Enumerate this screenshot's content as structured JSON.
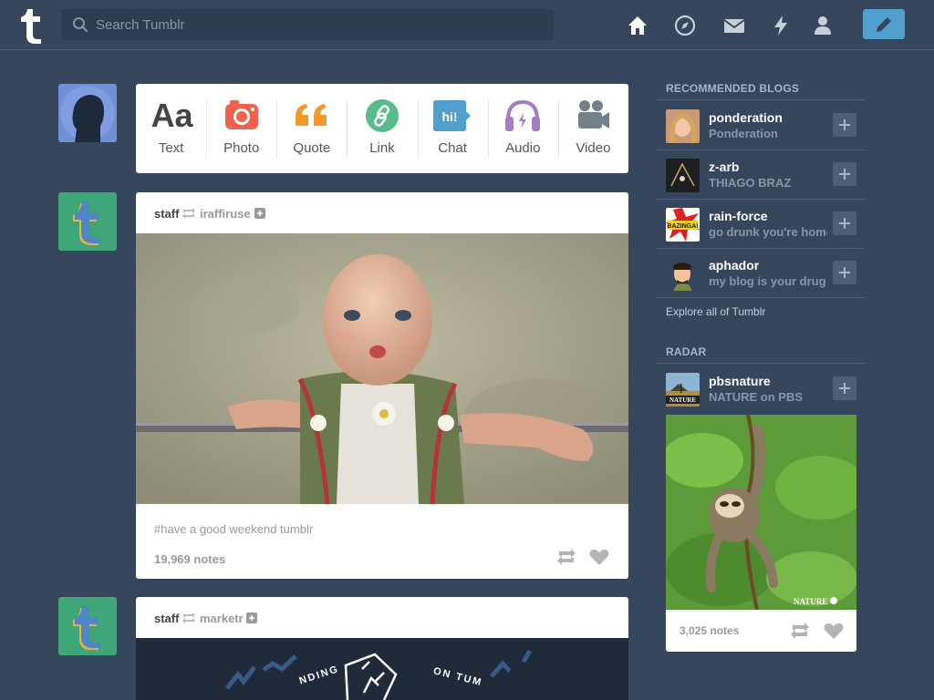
{
  "header": {
    "search_placeholder": "Search Tumblr",
    "nav_icons": [
      "home-icon",
      "explore-icon",
      "inbox-icon",
      "activity-icon",
      "account-icon"
    ],
    "compose_icon": "pencil-icon",
    "accent_color": "#529ecc",
    "background_color": "#36465d"
  },
  "post_types": [
    {
      "label": "Text",
      "icon": "text-icon",
      "color": "#444444"
    },
    {
      "label": "Photo",
      "icon": "camera-icon",
      "color": "#f0624e"
    },
    {
      "label": "Quote",
      "icon": "quote-icon",
      "color": "#f2992e"
    },
    {
      "label": "Link",
      "icon": "link-icon",
      "color": "#56bc8a"
    },
    {
      "label": "Chat",
      "icon": "chat-icon",
      "color": "#529ecc"
    },
    {
      "label": "Audio",
      "icon": "headphones-icon",
      "color": "#a77dc2"
    },
    {
      "label": "Video",
      "icon": "video-camera-icon",
      "color": "#748089"
    }
  ],
  "posts": [
    {
      "author": "staff",
      "reblogged_from": "iraffiruse",
      "tags": "#have a good weekend tumblr",
      "notes": "19,969 notes"
    },
    {
      "author": "staff",
      "reblogged_from": "marketr",
      "image_text": [
        "NDING",
        "ON TUM"
      ]
    }
  ],
  "sidebar": {
    "recommended_title": "RECOMMENDED BLOGS",
    "blogs": [
      {
        "name": "ponderation",
        "title": "Ponderation"
      },
      {
        "name": "z-arb",
        "title": "THIAGO BRAZ"
      },
      {
        "name": "rain-force",
        "title": "go drunk you're home",
        "avatar_text": "BAZINGA!"
      },
      {
        "name": "aphador",
        "title": "my blog is your drug"
      }
    ],
    "explore_label": "Explore all of Tumblr",
    "radar_title": "RADAR",
    "radar": {
      "name": "pbsnature",
      "title": "NATURE on PBS",
      "avatar_text": "NATURE",
      "image_watermark": "NATURE",
      "notes": "3,025 notes"
    }
  }
}
